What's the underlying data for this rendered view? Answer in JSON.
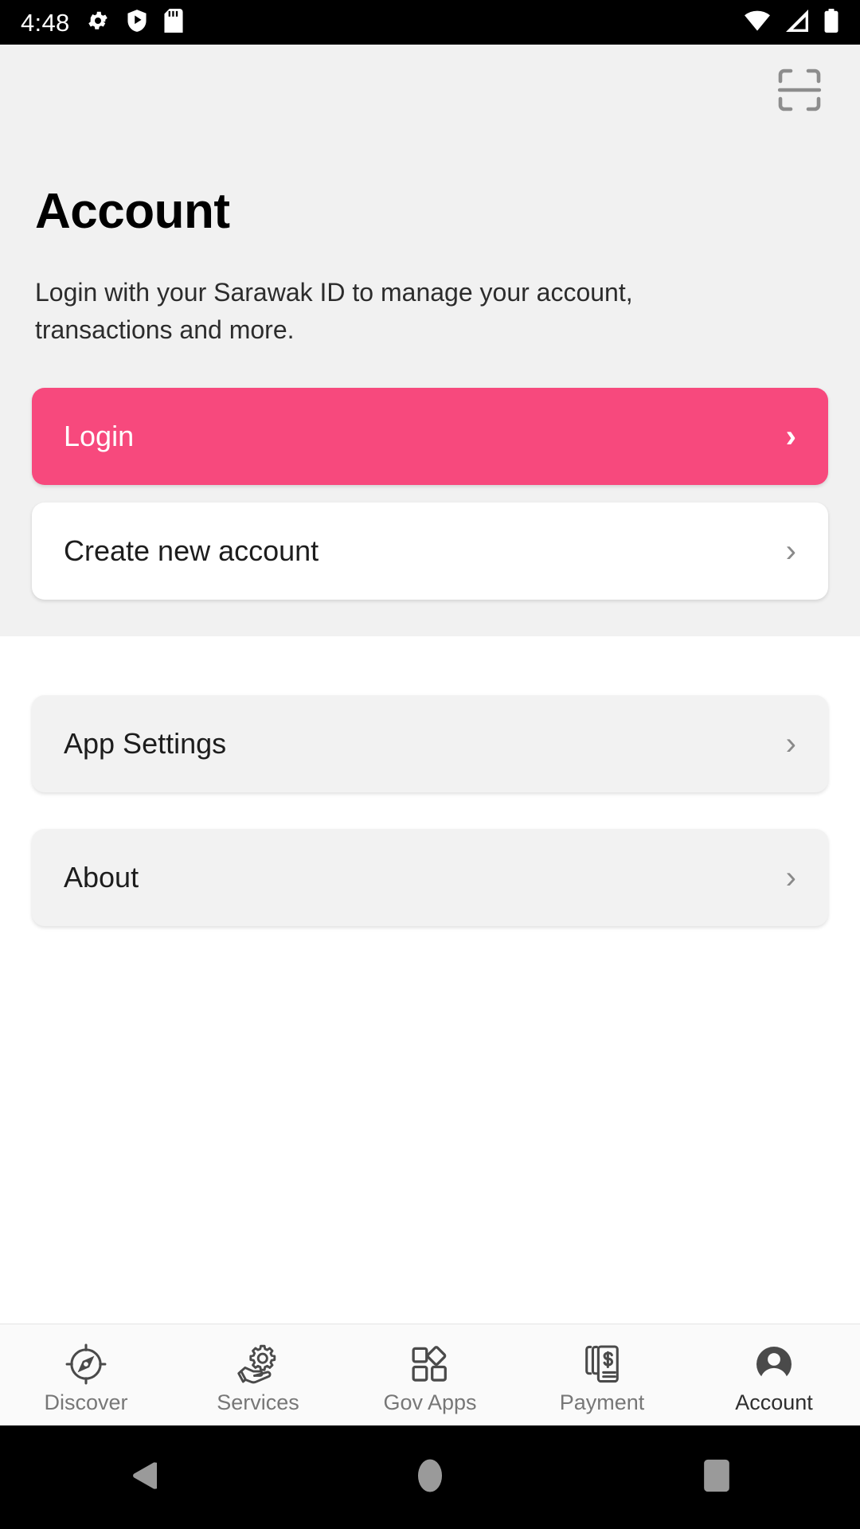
{
  "status_bar": {
    "time": "4:48",
    "left_icons": [
      "gear-icon",
      "play-protect-shield-icon",
      "sd-card-icon"
    ],
    "right_icons": [
      "wifi-icon",
      "cellular-signal-icon",
      "battery-full-icon"
    ]
  },
  "header": {
    "scan_icon": "qr-scan-icon",
    "title": "Account",
    "subtitle": "Login with your Sarawak ID to manage your account, transactions and more."
  },
  "auth_actions": [
    {
      "label": "Login",
      "chevron": "›",
      "style": "primary"
    },
    {
      "label": "Create new account",
      "chevron": "›",
      "style": "outline"
    }
  ],
  "settings_items": [
    {
      "label": "App Settings",
      "chevron": "›"
    },
    {
      "label": "About",
      "chevron": "›"
    }
  ],
  "tabbar": [
    {
      "label": "Discover",
      "icon": "compass-icon",
      "active": false
    },
    {
      "label": "Services",
      "icon": "hand-gear-icon",
      "active": false
    },
    {
      "label": "Gov Apps",
      "icon": "grid-apps-icon",
      "active": false
    },
    {
      "label": "Payment",
      "icon": "invoice-dollar-icon",
      "active": false
    },
    {
      "label": "Account",
      "icon": "user-avatar-icon",
      "active": true
    }
  ],
  "android_nav": [
    {
      "name": "back-button",
      "icon": "triangle-back-icon"
    },
    {
      "name": "home-button",
      "icon": "circle-home-icon"
    },
    {
      "name": "recents-button",
      "icon": "square-recents-icon"
    }
  ],
  "colors": {
    "primary_pink": "#f7497d",
    "page_bg_top": "#f1f1f1",
    "page_bg_bottom": "#ffffff",
    "card_grey": "#f2f2f2",
    "tabbar_bg": "#fafafa",
    "tab_inactive": "#777777",
    "tab_active": "#2f2f2f"
  }
}
